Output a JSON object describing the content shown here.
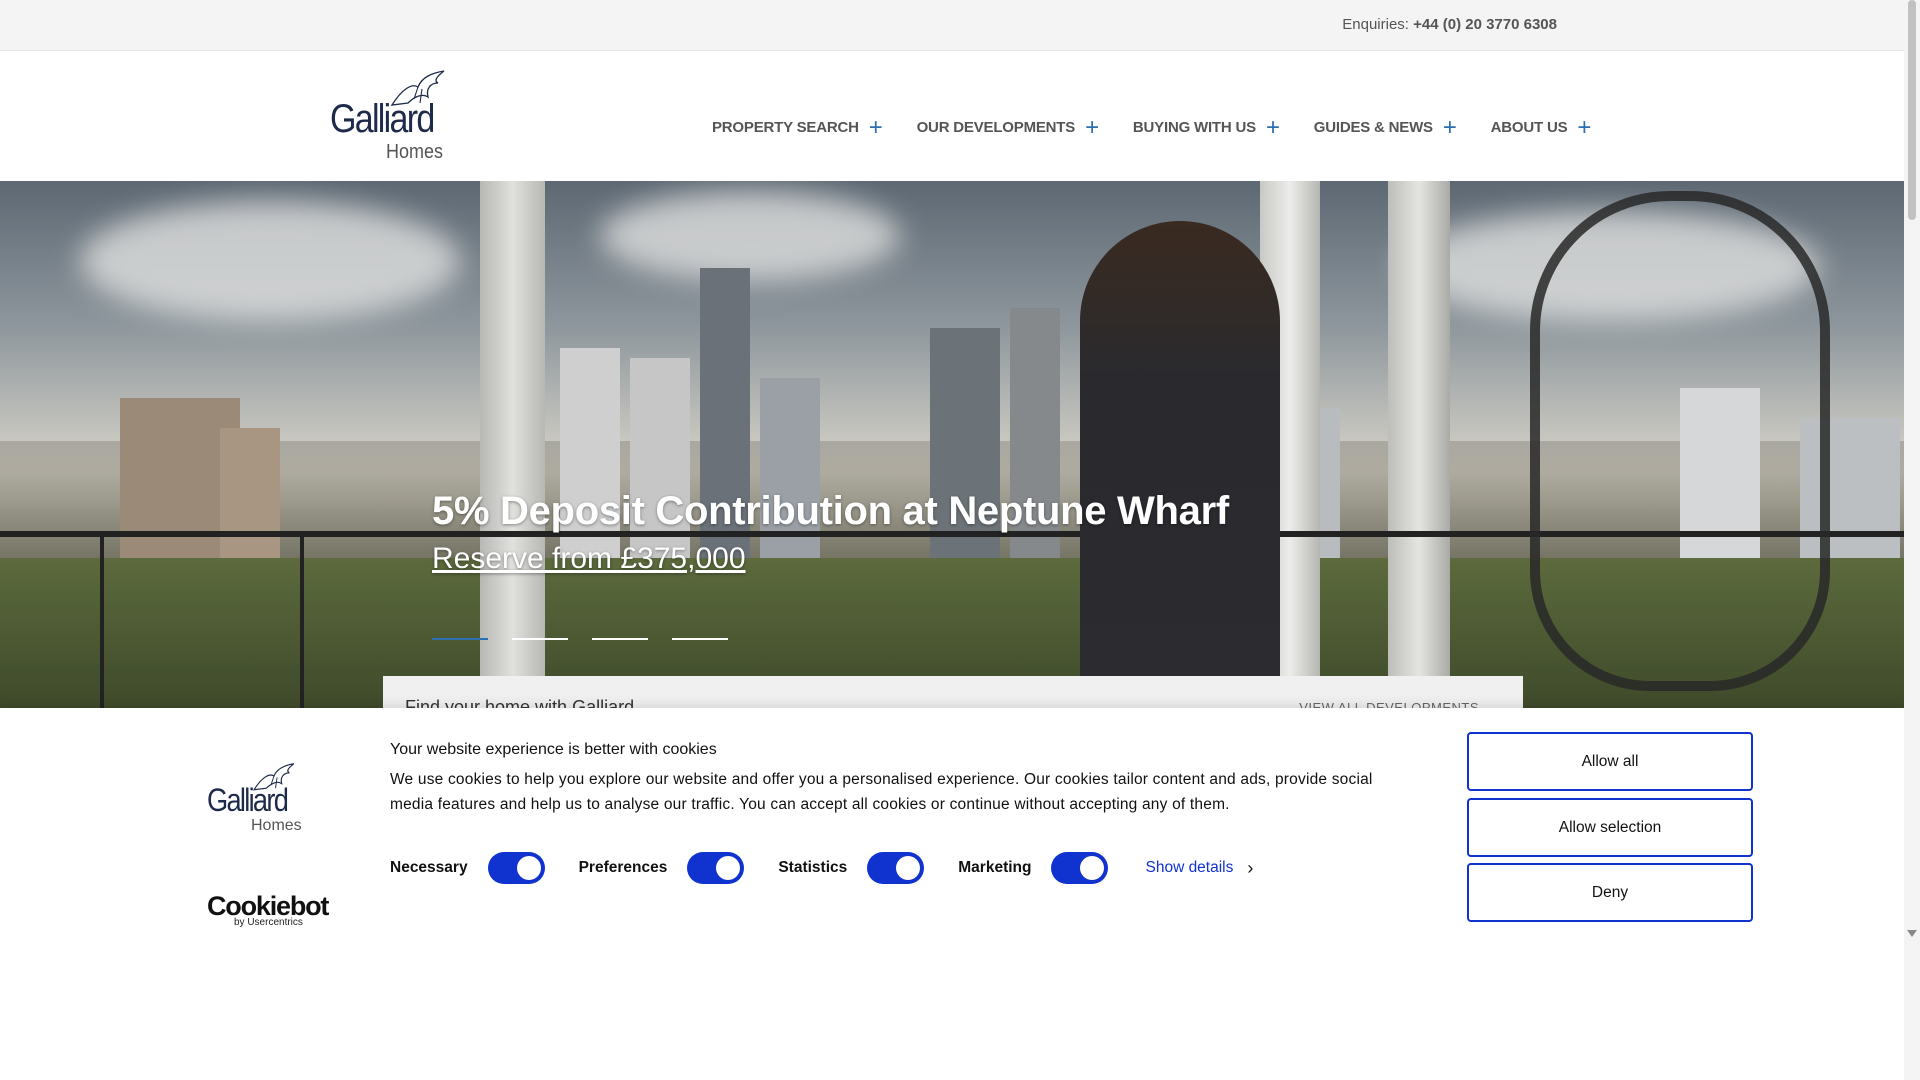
{
  "topbar": {
    "enquiries_label": "Enquiries:",
    "phone": "+44 (0) 20 3770 6308"
  },
  "brand": {
    "name_line1": "Galliard",
    "name_line2": "Homes",
    "color": "#1e2a4a"
  },
  "nav": {
    "items": [
      {
        "label": "PROPERTY SEARCH"
      },
      {
        "label": "OUR DEVELOPMENTS"
      },
      {
        "label": "BUYING WITH US"
      },
      {
        "label": "GUIDES & NEWS"
      },
      {
        "label": "ABOUT US"
      }
    ],
    "expand_icon": "plus-icon",
    "accent": "#2b6fb0"
  },
  "hero": {
    "title": "5% Deposit Contribution at Neptune Wharf",
    "subtitle": "Reserve from £375,000",
    "slides_total": 4,
    "active_slide": 1
  },
  "findbar": {
    "title": "Find your home with Galliard",
    "link": "VIEW ALL DEVELOPMENTS"
  },
  "cookie": {
    "title": "Your website experience is better with cookies",
    "text": "We use cookies to help you explore our website and offer you a personalised experience. Our cookies tailor content and ads, provide social media features and help us to analyse our traffic. You can accept all cookies or continue without accepting any of them.",
    "toggles": [
      {
        "label": "Necessary",
        "checked": true
      },
      {
        "label": "Preferences",
        "checked": true
      },
      {
        "label": "Statistics",
        "checked": true
      },
      {
        "label": "Marketing",
        "checked": true
      }
    ],
    "show_details": "Show details",
    "buttons": {
      "allow_all": "Allow all",
      "allow_selection": "Allow selection",
      "deny": "Deny"
    },
    "provider": "Cookiebot",
    "provider_sub": "by Usercentrics",
    "accent": "#1032cf"
  }
}
